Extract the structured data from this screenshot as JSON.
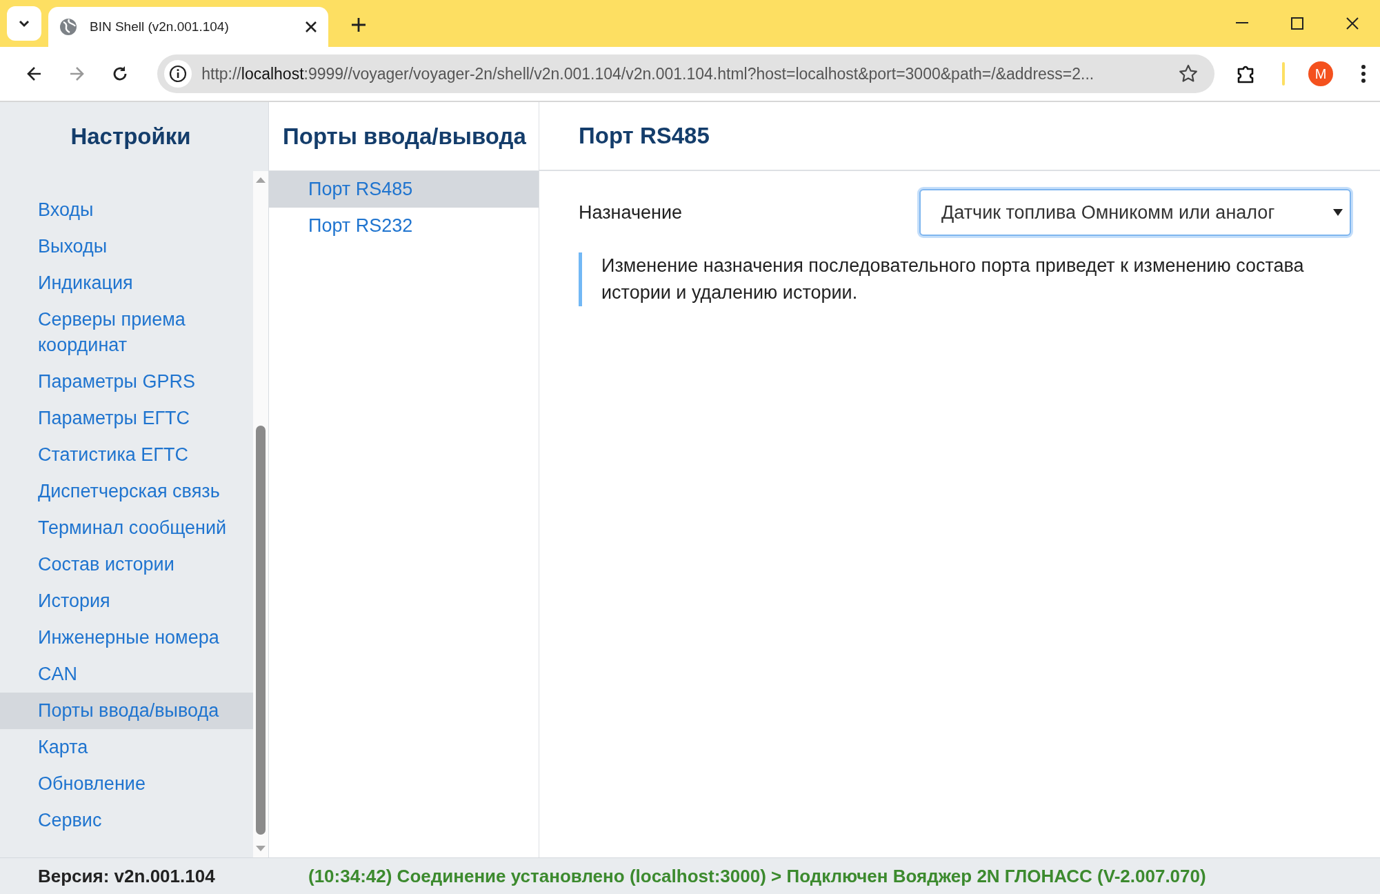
{
  "browser": {
    "tab_title": "BIN Shell (v2n.001.104)",
    "url_host": "localhost",
    "url_prefix": "http://",
    "url_rest": ":9999//voyager/voyager-2n/shell/v2n.001.104/v2n.001.104.html?host=localhost&port=3000&path=/&address=2...",
    "profile_initial": "M"
  },
  "sidebar": {
    "title": "Настройки",
    "items": [
      {
        "label": "Входы",
        "selected": false
      },
      {
        "label": "Выходы",
        "selected": false
      },
      {
        "label": "Индикация",
        "selected": false
      },
      {
        "label": "Серверы приема координат",
        "selected": false
      },
      {
        "label": "Параметры GPRS",
        "selected": false
      },
      {
        "label": "Параметры ЕГТС",
        "selected": false
      },
      {
        "label": "Статистика ЕГТС",
        "selected": false
      },
      {
        "label": "Диспетчерская связь",
        "selected": false
      },
      {
        "label": "Терминал сообщений",
        "selected": false
      },
      {
        "label": "Состав истории",
        "selected": false
      },
      {
        "label": "История",
        "selected": false
      },
      {
        "label": "Инженерные номера",
        "selected": false
      },
      {
        "label": "CAN",
        "selected": false
      },
      {
        "label": "Порты ввода/вывода",
        "selected": true
      },
      {
        "label": "Карта",
        "selected": false
      },
      {
        "label": "Обновление",
        "selected": false
      },
      {
        "label": "Сервис",
        "selected": false
      }
    ]
  },
  "ports": {
    "title": "Порты ввода/вывода",
    "items": [
      {
        "label": "Порт RS485",
        "selected": true
      },
      {
        "label": "Порт RS232",
        "selected": false
      }
    ]
  },
  "content": {
    "title": "Порт RS485",
    "field": {
      "label": "Назначение",
      "value": "Датчик топлива Омникомм или аналог"
    },
    "note": "Изменение назначения последовательного порта приведет к изменению состава истории и удалению истории."
  },
  "status_bar": {
    "version": "Версия: v2n.001.104",
    "message": "(10:34:42) Соединение установлено (localhost:3000) > Подключен Вояджер 2N ГЛОНАСС (V-2.007.070)"
  }
}
